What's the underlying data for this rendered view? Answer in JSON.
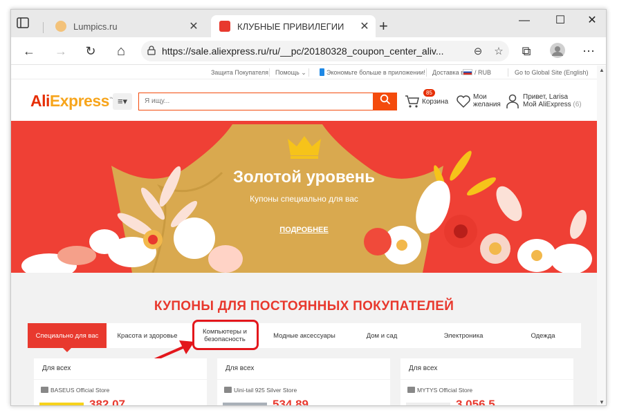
{
  "browser": {
    "tabs": [
      {
        "title": "Lumpics.ru",
        "active": false,
        "favicon_color": "#f3c27a"
      },
      {
        "title": "КЛУБНЫЕ ПРИВИЛЕГИИ",
        "active": true,
        "favicon_color": "#e8392e"
      }
    ],
    "close_glyph": "✕",
    "newtab_glyph": "+",
    "window_controls": {
      "minimize": "—",
      "maximize": "☐",
      "close": "✕"
    },
    "nav": {
      "back": "←",
      "forward": "→",
      "refresh": "↻",
      "home": "⌂",
      "lock": "🔒",
      "zoom": "⊖",
      "favorite": "☆",
      "collections": "⧉",
      "profile": "●",
      "menu": "⋯"
    },
    "url": "https://sale.aliexpress.ru/ru/__pc/20180328_coupon_center_aliv..."
  },
  "topbar": {
    "buyer_protection": "Защита Покупателя",
    "help": "Помощь ⌄",
    "app": "Экономьте больше в приложении!",
    "delivery": "Доставка в",
    "currency": "/ RUB",
    "global": "Go to Global Site (English)"
  },
  "header": {
    "logo_ali": "Ali",
    "logo_express": "Express",
    "search_placeholder": "Я ищу...",
    "search_icon": "⌕",
    "cart_count": "85",
    "cart_label": "Корзина",
    "wishlist_label_1": "Мои",
    "wishlist_label_2": "желания",
    "account_greeting": "Привет, Larisa",
    "account_link": "Мой AliExpress",
    "account_count": "(6)"
  },
  "banner": {
    "title": "Золотой уровень",
    "subtitle": "Купоны специально для вас",
    "link": "ПОДРОБНЕЕ",
    "colors": {
      "background": "#ef4035",
      "crown": "#d9a94f"
    }
  },
  "section_title": "КУПОНЫ ДЛЯ ПОСТОЯННЫХ ПОКУПАТЕЛЕЙ",
  "category_tabs": [
    {
      "label": "Специально для вас",
      "active": true
    },
    {
      "label": "Красота и здоровье",
      "active": false
    },
    {
      "label": "Компьютеры и безопасность",
      "active": false
    },
    {
      "label": "Модные аксессуары",
      "active": false
    },
    {
      "label": "Дом и сад",
      "active": false
    },
    {
      "label": "Электроника",
      "active": false
    },
    {
      "label": "Одежда",
      "active": false
    }
  ],
  "coupons": [
    {
      "audience": "Для всех",
      "store": "BASEUS Official Store",
      "price": "382.07 ..."
    },
    {
      "audience": "Для всех",
      "store": "Uini-tail 925 Silver Store",
      "price": "534.89 ..."
    },
    {
      "audience": "Для всех",
      "store": "MYTYS Official Store",
      "price": "3 056.5..."
    }
  ]
}
